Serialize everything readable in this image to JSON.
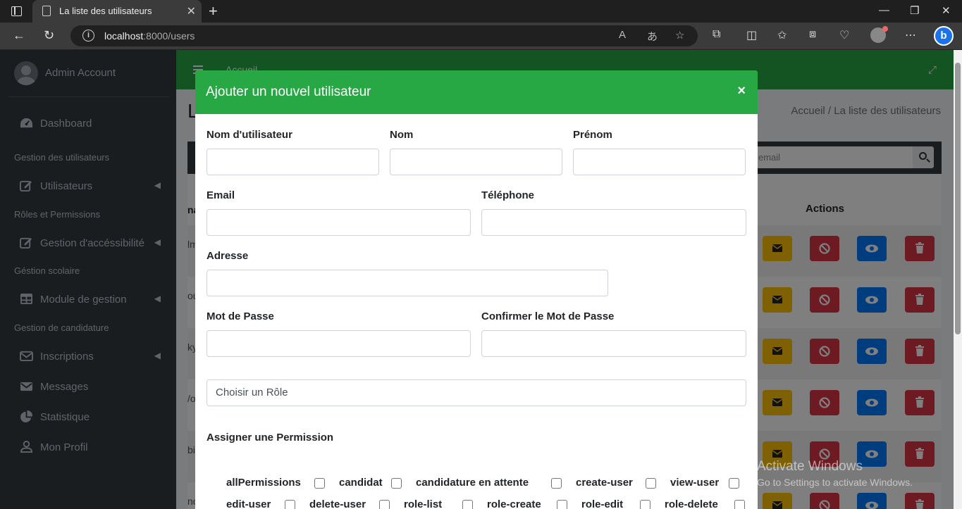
{
  "browser": {
    "tab_title": "La liste des utilisateurs",
    "url_host": "localhost",
    "url_path": ":8000/users"
  },
  "sidebar": {
    "user_name": "Admin Account",
    "dashboard": "Dashboard",
    "sections": [
      {
        "header": "Gestion des utilisateurs",
        "item": "Utilisateurs"
      },
      {
        "header": "Rôles et Permissions",
        "item": "Gestion d'accéssibilité"
      },
      {
        "header": "Géstion scolaire",
        "item": "Module de gestion"
      },
      {
        "header": "Gestion de candidature",
        "item": "Inscriptions"
      }
    ],
    "messages": "Messages",
    "statistique": "Statistique",
    "profil": "Mon Profil"
  },
  "page": {
    "nav_home": "Accueil",
    "title_fragment": "L",
    "breadcrumb_home": "Accueil",
    "breadcrumb_sep": " / ",
    "breadcrumb_current": "La liste des utilisateurs",
    "search_placeholder": "email",
    "col_fragment": "na",
    "actions_header": "Actions",
    "row_fragments": [
      "lm",
      "ou",
      "ky",
      "/o",
      "bi",
      "no"
    ]
  },
  "modal": {
    "title": "Ajouter un nouvel utilisateur",
    "close": "×",
    "labels": {
      "username": "Nom d'utilisateur",
      "nom": "Nom",
      "prenom": "Prénom",
      "email": "Email",
      "telephone": "Téléphone",
      "adresse": "Adresse",
      "password": "Mot de Passe",
      "password_confirm": "Confirmer le Mot de Passe"
    },
    "role_placeholder": "Choisir un Rôle",
    "permission_title": "Assigner une Permission",
    "permissions_row1": [
      "allPermissions",
      "candidat",
      "candidature en attente",
      "create-user",
      "view-user"
    ],
    "permissions_row2": [
      "edit-user",
      "delete-user",
      "role-list",
      "role-create",
      "role-edit",
      "role-delete"
    ]
  },
  "watermark": {
    "line1": "Activate Windows",
    "line2": "Go to Settings to activate Windows."
  },
  "colors": {
    "success": "#28a745",
    "warning": "#ffc107",
    "danger": "#dc3545",
    "primary": "#007bff",
    "sidebar": "#343a40"
  }
}
